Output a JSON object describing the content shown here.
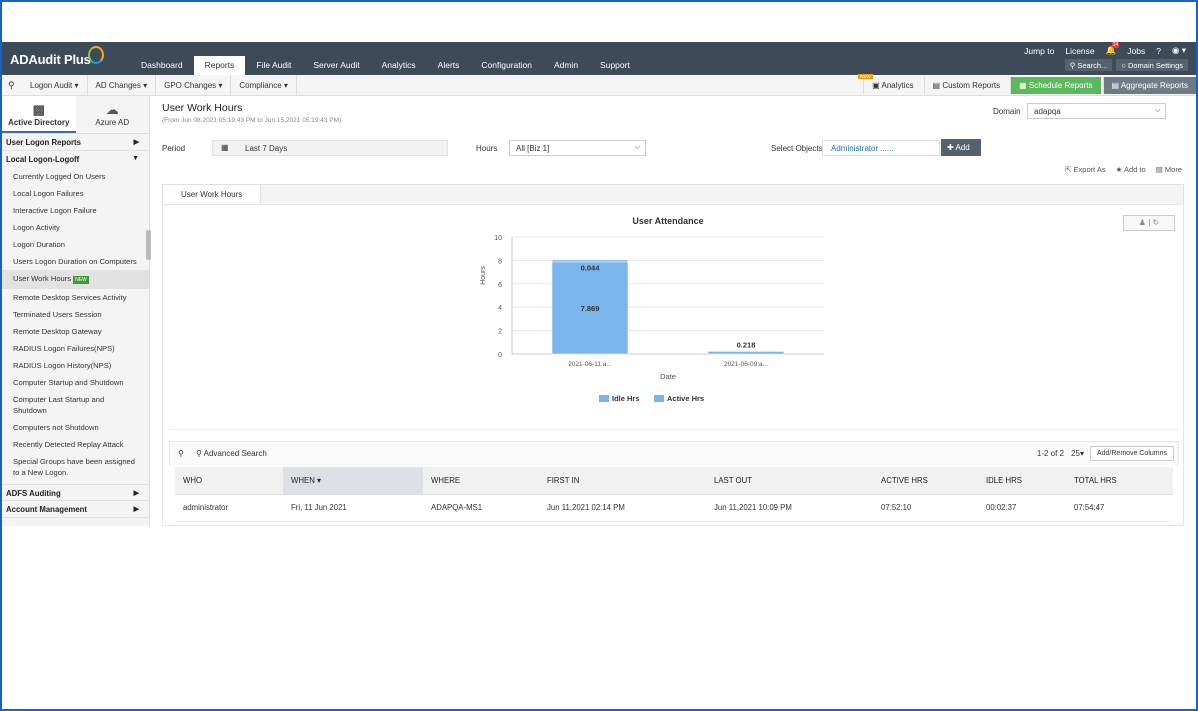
{
  "app": {
    "name": "ADAudit Plus",
    "nav": [
      "Dashboard",
      "Reports",
      "File Audit",
      "Server Audit",
      "Analytics",
      "Alerts",
      "Configuration",
      "Admin",
      "Support"
    ],
    "top_links": {
      "jump_to": "Jump to",
      "license": "License",
      "bell_count": "14",
      "jobs": "Jobs",
      "help": "?"
    },
    "search_btn": "Search...",
    "domain_settings_btn": "Domain Settings"
  },
  "subnav": {
    "items": [
      "Logon Audit",
      "AD Changes",
      "GPO Changes",
      "Compliance"
    ],
    "analytics": "Analytics",
    "new_flag": "NEW",
    "custom_reports": "Custom Reports",
    "schedule_reports": "Schedule Reports",
    "aggregate_reports": "Aggregate Reports"
  },
  "sidebar": {
    "tabs": [
      {
        "label": "Active Directory",
        "icon": "building-icon"
      },
      {
        "label": "Azure AD",
        "icon": "cloud-icon"
      }
    ],
    "categories": {
      "user_logon_reports": "User Logon Reports",
      "local_logon_logoff": "Local Logon-Logoff",
      "adfs_auditing": "ADFS Auditing",
      "account_management": "Account Management"
    },
    "items": [
      "Currently Logged On Users",
      "Local Logon Failures",
      "Interactive Logon Failure",
      "Logon Activity",
      "Logon Duration",
      "Users Logon Duration on Computers",
      "User Work Hours",
      "Remote Desktop Services Activity",
      "Terminated Users Session",
      "Remote Desktop Gateway",
      "RADIUS Logon Failures(NPS)",
      "RADIUS Logon History(NPS)",
      "Computer Startup and Shutdown",
      "Computer Last Startup and Shutdown",
      "Computers not Shutdown",
      "Recently Detected Replay Attack",
      "Special Groups have been assigned to a New Logon."
    ],
    "new_badge": "NEW"
  },
  "report": {
    "title": "User Work Hours",
    "subtitle": "(From Jun 08,2021 05:19:43 PM to Jun 15,2021 05:19:43 PM)",
    "domain_label": "Domain",
    "domain_value": "adapqa",
    "period_label": "Period",
    "period_value": "Last 7 Days",
    "hours_label": "Hours",
    "hours_value": "All [Biz 1]",
    "objects_label": "Select Objects",
    "objects_value": "Administrator ......",
    "add_label": "Add",
    "export_as": "Export As",
    "add_to": "Add to",
    "more": "More",
    "tab": "User Work Hours"
  },
  "chart_data": {
    "type": "bar",
    "stacked": true,
    "title": "User Attendance",
    "xlabel": "Date",
    "ylabel": "Hours",
    "categories": [
      "2021-06-11:a...",
      "2021-06-09:a..."
    ],
    "ylim": [
      0,
      10
    ],
    "yticks": [
      0,
      2,
      4,
      6,
      8,
      10
    ],
    "series": [
      {
        "name": "Active Hrs",
        "values": [
          7.869,
          0.218
        ],
        "color": "#7cb5ec"
      },
      {
        "name": "Idle Hrs",
        "values": [
          0.044,
          0
        ],
        "color": "#7cb5ec"
      }
    ],
    "data_labels": [
      [
        "7.869",
        "0.044"
      ],
      [
        "0.218"
      ]
    ],
    "legend": [
      "Idle Hrs",
      "Active Hrs"
    ],
    "legend_position": "bottom"
  },
  "grid": {
    "advanced_search": "Advanced Search",
    "pagination": "1-2 of 2",
    "per_page": "25",
    "add_remove_columns": "Add/Remove Columns",
    "columns": [
      "WHO",
      "WHEN",
      "WHERE",
      "FIRST IN",
      "LAST OUT",
      "ACTIVE HRS",
      "IDLE HRS",
      "TOTAL HRS"
    ],
    "rows": [
      {
        "who": "administrator",
        "when": "Fri, 11 Jun 2021",
        "where": "ADAPQA-MS1",
        "first_in": "Jun 11,2021 02:14 PM",
        "last_out": "Jun 11,2021 10:09 PM",
        "active": "07:52:10",
        "idle": "00:02:37",
        "total": "07:54:47"
      }
    ]
  }
}
